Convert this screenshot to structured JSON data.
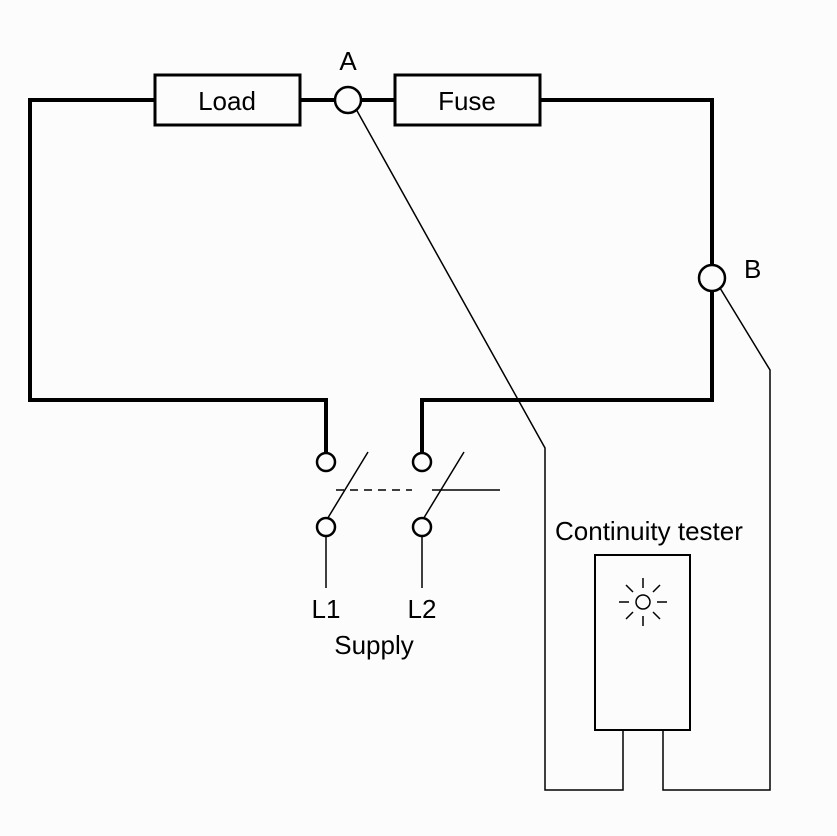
{
  "nodes": {
    "A": "A",
    "B": "B"
  },
  "components": {
    "load": "Load",
    "fuse": "Fuse"
  },
  "supply": {
    "left": "L1",
    "right": "L2",
    "label": "Supply"
  },
  "tester": {
    "label": "Continuity tester"
  }
}
